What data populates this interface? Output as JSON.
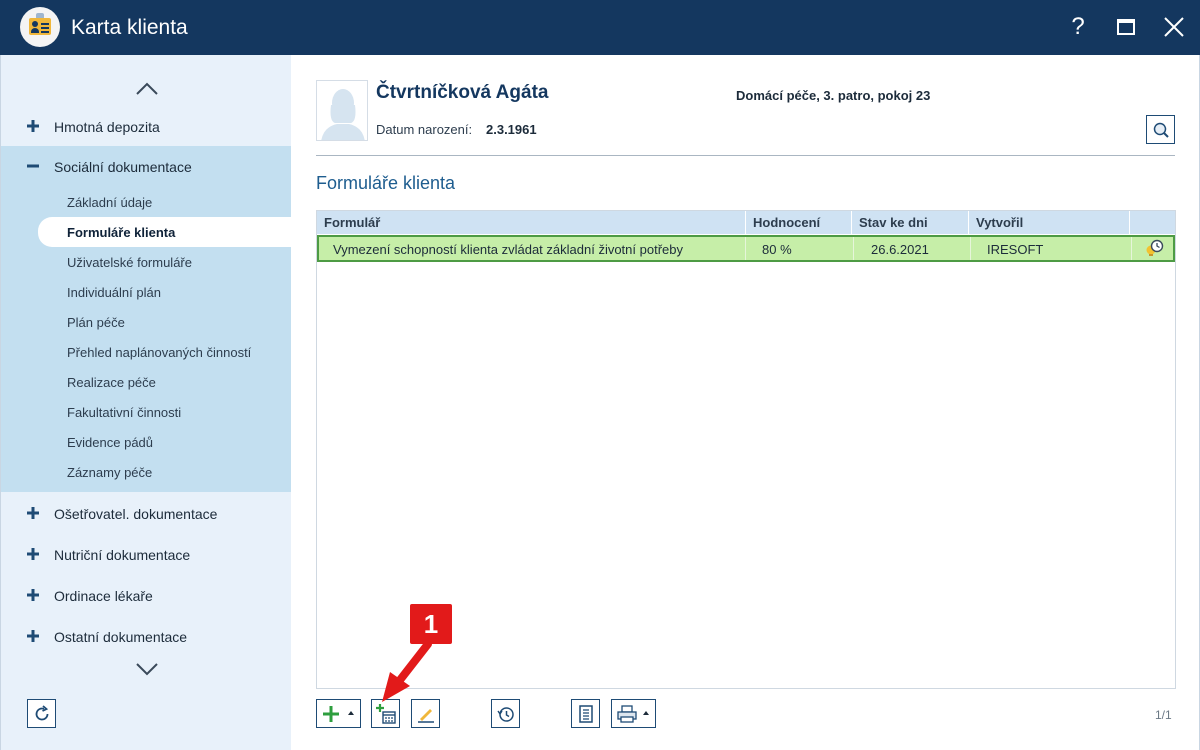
{
  "window": {
    "title": "Karta klienta",
    "help_label": "?"
  },
  "sidebar": {
    "sections": [
      {
        "label": "Hmotná depozita",
        "expanded": false
      },
      {
        "label": "Sociální dokumentace",
        "expanded": true
      },
      {
        "label": "Ošetřovatel. dokumentace",
        "expanded": false
      },
      {
        "label": "Nutriční dokumentace",
        "expanded": false
      },
      {
        "label": "Ordinace lékaře",
        "expanded": false
      },
      {
        "label": "Ostatní dokumentace",
        "expanded": false
      }
    ],
    "sub_items": [
      {
        "label": "Základní údaje"
      },
      {
        "label": "Formuláře klienta",
        "active": true
      },
      {
        "label": "Uživatelské formuláře"
      },
      {
        "label": "Individuální plán"
      },
      {
        "label": "Plán péče"
      },
      {
        "label": "Přehled naplánovaných činností"
      },
      {
        "label": "Realizace péče"
      },
      {
        "label": "Fakultativní činnosti"
      },
      {
        "label": "Evidence pádů"
      },
      {
        "label": "Záznamy péče"
      }
    ]
  },
  "client": {
    "name": "Čtvrtníčková Agáta",
    "location": "Domácí péče, 3. patro, pokoj 23",
    "dob_label": "Datum narození:",
    "dob_value": "2.3.1961"
  },
  "main": {
    "section_title": "Formuláře klienta",
    "table": {
      "columns": [
        "Formulář",
        "Hodnocení",
        "Stav ke dni",
        "Vytvořil"
      ],
      "rows": [
        {
          "form": "Vymezení schopností klienta zvládat základní životní potřeby",
          "rating": "80 %",
          "date": "26.6.2021",
          "author": "IRESOFT",
          "icon": "history-lightbulb-icon"
        }
      ]
    },
    "pager": "1/1"
  },
  "callout": {
    "number": "1"
  },
  "colors": {
    "titlebar": "#14375f",
    "sidebar_bg": "#e8f1fa",
    "selected_section_bg": "#c3dff0",
    "selected_row_bg": "#c6eea8",
    "selected_row_border": "#4d9b44",
    "callout": "#e21a1a"
  }
}
